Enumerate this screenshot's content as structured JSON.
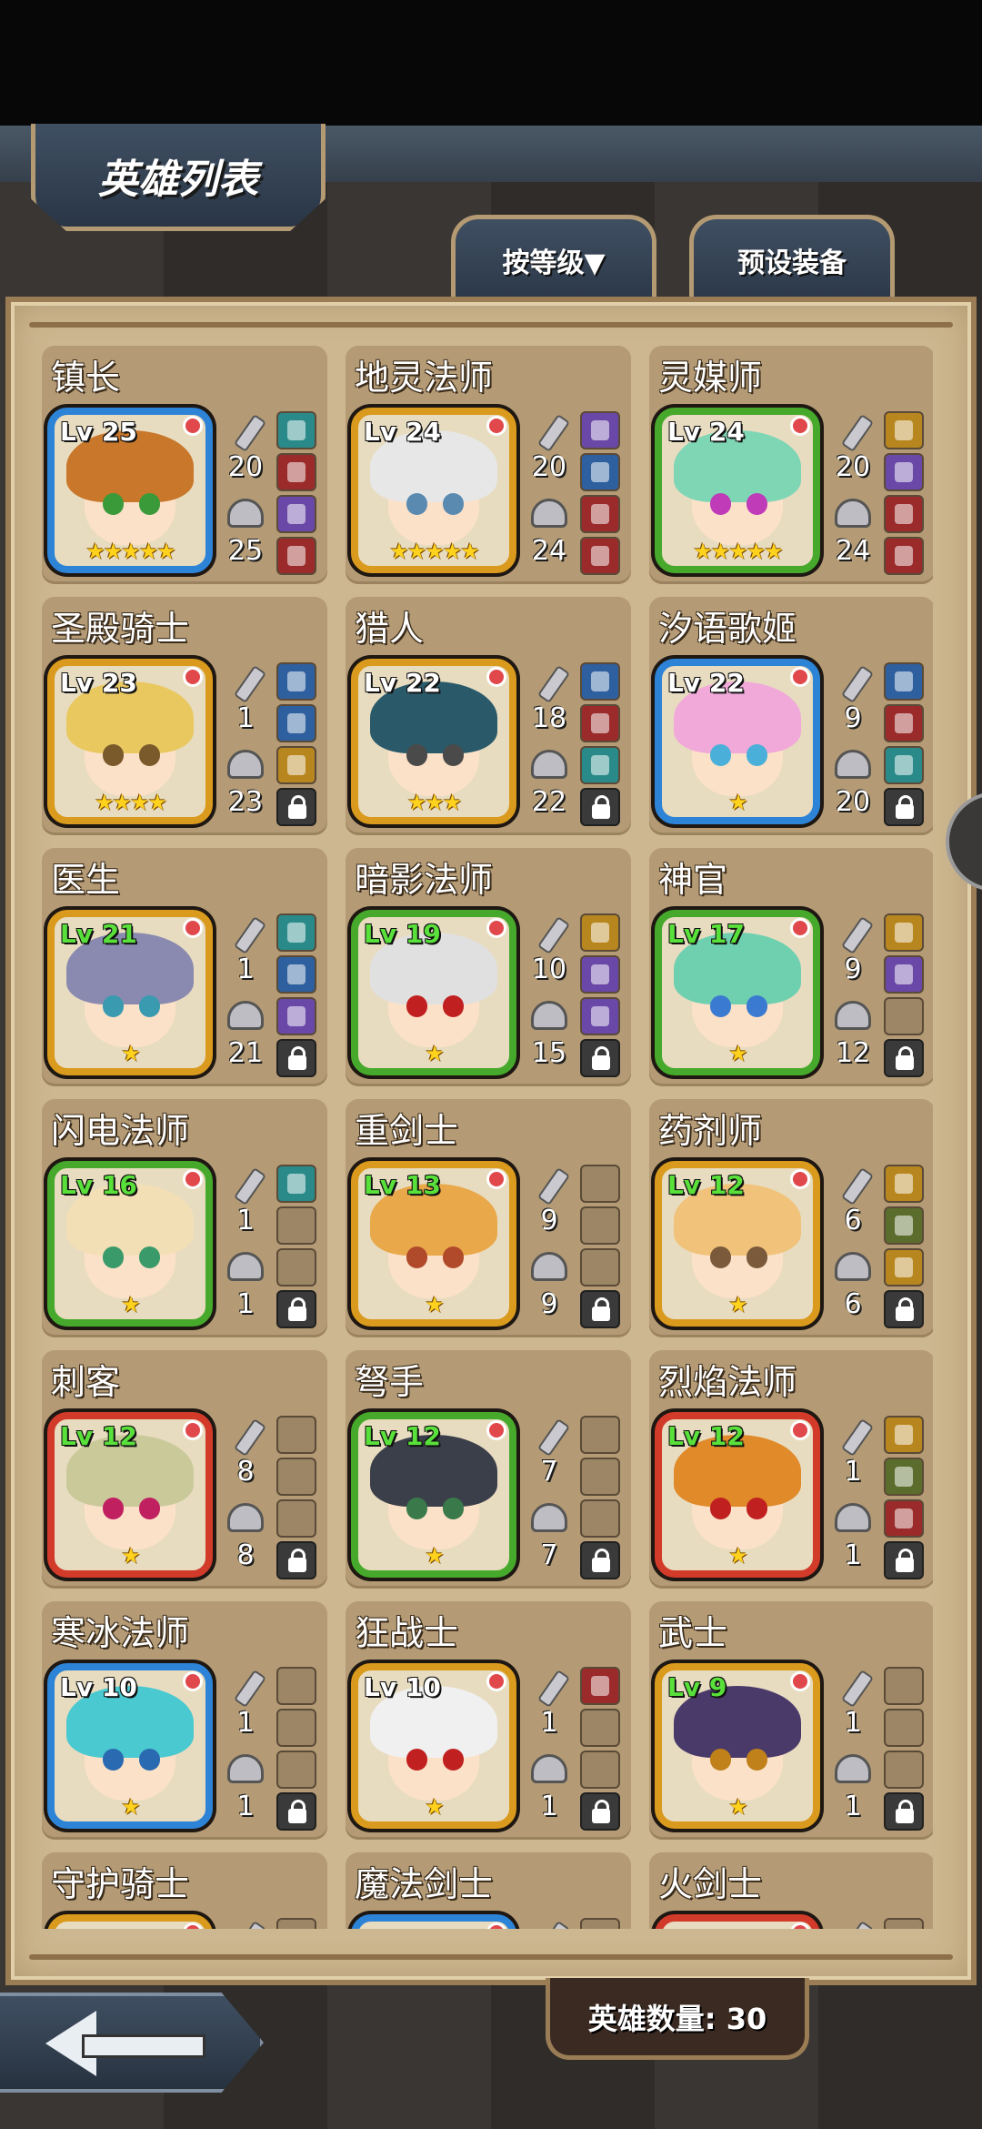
{
  "header": {
    "title": "英雄列表"
  },
  "toolbar": {
    "sort_label": "按等级▼",
    "preset_label": "预设装备"
  },
  "footer": {
    "hero_count": "英雄数量: 30"
  },
  "heroes": [
    {
      "name": "镇长",
      "level": "Lv 25",
      "stars": "★★★★★",
      "atk": "20",
      "def": "25",
      "frame": "blue",
      "lvcolor": "white",
      "hair": "#c9772a",
      "eye": "#3a9a3a",
      "slots": [
        "teal",
        "red",
        "f",
        "red"
      ]
    },
    {
      "name": "地灵法师",
      "level": "Lv 24",
      "stars": "★★★★★",
      "atk": "20",
      "def": "24",
      "frame": "gold",
      "lvcolor": "white",
      "hair": "#e7e7e7",
      "eye": "#5a8ab0",
      "slots": [
        "f",
        "blue",
        "red",
        "red"
      ]
    },
    {
      "name": "灵媒师",
      "level": "Lv 24",
      "stars": "★★★★★",
      "atk": "20",
      "def": "24",
      "frame": "green",
      "lvcolor": "white",
      "hair": "#7fd6b5",
      "eye": "#c03bb8",
      "slots": [
        "gold",
        "f",
        "red",
        "red"
      ]
    },
    {
      "name": "圣殿骑士",
      "level": "Lv 23",
      "stars": "★★★★",
      "atk": "1",
      "def": "23",
      "frame": "gold",
      "lvcolor": "white",
      "hair": "#e9c860",
      "eye": "#7a5a2a",
      "slots": [
        "blue",
        "blue",
        "gold",
        "lock"
      ]
    },
    {
      "name": "猎人",
      "level": "Lv 22",
      "stars": "★★★",
      "atk": "18",
      "def": "22",
      "frame": "gold",
      "lvcolor": "white",
      "hair": "#2a5a6a",
      "eye": "#4a4a4a",
      "slots": [
        "blue",
        "red",
        "teal",
        "lock"
      ]
    },
    {
      "name": "汐语歌姬",
      "level": "Lv 22",
      "stars": "★",
      "atk": "9",
      "def": "20",
      "frame": "blue",
      "lvcolor": "white",
      "hair": "#f0a9d9",
      "eye": "#4ab0d9",
      "slots": [
        "blue",
        "red",
        "teal",
        "lock"
      ]
    },
    {
      "name": "医生",
      "level": "Lv 21",
      "stars": "★",
      "atk": "1",
      "def": "21",
      "frame": "gold",
      "lvcolor": "green",
      "hair": "#8a8ab0",
      "eye": "#3a9ab0",
      "slots": [
        "teal",
        "blue",
        "f",
        "lock"
      ]
    },
    {
      "name": "暗影法师",
      "level": "Lv 19",
      "stars": "★",
      "atk": "10",
      "def": "15",
      "frame": "green",
      "lvcolor": "green",
      "hair": "#e0e0e0",
      "eye": "#c02020",
      "slots": [
        "gold",
        "f",
        "f",
        "lock"
      ]
    },
    {
      "name": "神官",
      "level": "Lv 17",
      "stars": "★",
      "atk": "9",
      "def": "12",
      "frame": "green",
      "lvcolor": "green",
      "hair": "#6fd0b0",
      "eye": "#3a7ad0",
      "slots": [
        "gold",
        "f",
        "empty",
        "lock"
      ]
    },
    {
      "name": "闪电法师",
      "level": "Lv 16",
      "stars": "★",
      "atk": "1",
      "def": "1",
      "frame": "green",
      "lvcolor": "green",
      "hair": "#f3dfb5",
      "eye": "#3a9a6a",
      "slots": [
        "teal",
        "empty",
        "empty",
        "lock"
      ]
    },
    {
      "name": "重剑士",
      "level": "Lv 13",
      "stars": "★",
      "atk": "9",
      "def": "9",
      "frame": "gold",
      "lvcolor": "green",
      "hair": "#e9a84a",
      "eye": "#b04a2a",
      "slots": [
        "empty",
        "empty",
        "empty",
        "lock"
      ]
    },
    {
      "name": "药剂师",
      "level": "Lv 12",
      "stars": "★",
      "atk": "6",
      "def": "6",
      "frame": "gold",
      "lvcolor": "green",
      "hair": "#f0c27a",
      "eye": "#7a5a3a",
      "slots": [
        "gold",
        "olive",
        "gold",
        "lock"
      ]
    },
    {
      "name": "刺客",
      "level": "Lv 12",
      "stars": "★",
      "atk": "8",
      "def": "8",
      "frame": "red",
      "lvcolor": "green",
      "hair": "#c9c99a",
      "eye": "#c02060",
      "slots": [
        "empty",
        "empty",
        "empty",
        "lock"
      ]
    },
    {
      "name": "弩手",
      "level": "Lv 12",
      "stars": "★",
      "atk": "7",
      "def": "7",
      "frame": "green",
      "lvcolor": "green",
      "hair": "#3a3f4a",
      "eye": "#3a7a4a",
      "slots": [
        "empty",
        "empty",
        "empty",
        "lock"
      ]
    },
    {
      "name": "烈焰法师",
      "level": "Lv 12",
      "stars": "★",
      "atk": "1",
      "def": "1",
      "frame": "red",
      "lvcolor": "green",
      "hair": "#e08a2a",
      "eye": "#c02020",
      "slots": [
        "gold",
        "olive",
        "red",
        "lock"
      ]
    },
    {
      "name": "寒冰法师",
      "level": "Lv 10",
      "stars": "★",
      "atk": "1",
      "def": "1",
      "frame": "blue",
      "lvcolor": "white",
      "hair": "#4ac9d0",
      "eye": "#2a6ab0",
      "slots": [
        "empty",
        "empty",
        "empty",
        "lock"
      ]
    },
    {
      "name": "狂战士",
      "level": "Lv 10",
      "stars": "★",
      "atk": "1",
      "def": "1",
      "frame": "gold",
      "lvcolor": "white",
      "hair": "#f0f0f0",
      "eye": "#c02020",
      "slots": [
        "red",
        "empty",
        "empty",
        "lock"
      ]
    },
    {
      "name": "武士",
      "level": "Lv 9",
      "stars": "★",
      "atk": "1",
      "def": "1",
      "frame": "gold",
      "lvcolor": "green",
      "hair": "#4a3a6a",
      "eye": "#c0801a",
      "slots": [
        "empty",
        "empty",
        "empty",
        "lock"
      ]
    },
    {
      "name": "守护骑士",
      "level": "",
      "stars": "",
      "atk": "",
      "def": "",
      "frame": "gold",
      "lvcolor": "white",
      "hair": "#c0a070",
      "eye": "#444",
      "slots": [
        "empty",
        "empty",
        "empty",
        "lock"
      ]
    },
    {
      "name": "魔法剑士",
      "level": "",
      "stars": "",
      "atk": "",
      "def": "",
      "frame": "blue",
      "lvcolor": "white",
      "hair": "#c0a070",
      "eye": "#444",
      "slots": [
        "empty",
        "empty",
        "empty",
        "lock"
      ]
    },
    {
      "name": "火剑士",
      "level": "",
      "stars": "",
      "atk": "",
      "def": "",
      "frame": "red",
      "lvcolor": "white",
      "hair": "#c0a070",
      "eye": "#444",
      "slots": [
        "empty",
        "empty",
        "empty",
        "lock"
      ]
    }
  ]
}
